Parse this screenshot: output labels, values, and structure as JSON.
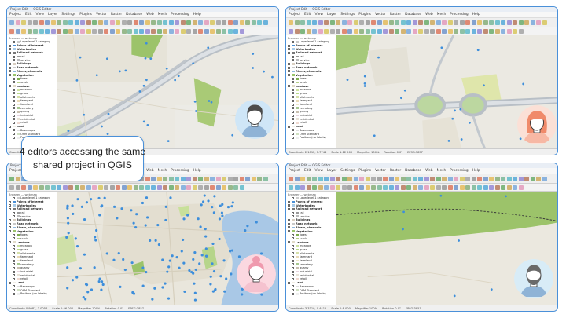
{
  "caption": {
    "line1": "4 editors accessing the same",
    "line2": "shared project in QGIS"
  },
  "window": {
    "title": "Project Edit — QGIS Editor",
    "menus": [
      "Project",
      "Edit",
      "View",
      "Layer",
      "Settings",
      "Plugins",
      "Vector",
      "Raster",
      "Database",
      "Web",
      "Mesh",
      "Processing",
      "Help"
    ]
  },
  "layers_panel": {
    "header": "Browser — webmap",
    "items": [
      {
        "label": "Layerlevel 1 category",
        "style": "normal",
        "swatch": "#cccccc"
      },
      {
        "label": "Points of interest",
        "style": "bold",
        "swatch": "#4a8fd6"
      },
      {
        "label": "Waterbodies",
        "style": "bold",
        "swatch": "#a9cbe8"
      },
      {
        "label": "Railroad network",
        "style": "bold",
        "swatch": "#777777"
      },
      {
        "label": "rail",
        "style": "normal",
        "swatch": "#999999"
      },
      {
        "label": "service",
        "style": "normal",
        "swatch": "#bbbbbb"
      },
      {
        "label": "Buildings",
        "style": "bold",
        "swatch": "#d9cfc1"
      },
      {
        "label": "Road network",
        "style": "bold",
        "swatch": "#c9c9c9"
      },
      {
        "label": "Rivers, channels",
        "style": "bold",
        "swatch": "#8fb8de"
      },
      {
        "label": "Vegetation",
        "style": "bold",
        "swatch": "#9bc56b"
      },
      {
        "label": "forest",
        "style": "normal",
        "swatch": "#7fae4f"
      },
      {
        "label": "scrub",
        "style": "normal",
        "swatch": "#b7d08a"
      },
      {
        "label": "Landuse",
        "style": "bold",
        "swatch": "#e2dcc8"
      },
      {
        "label": "meadow",
        "style": "normal",
        "swatch": "#cfe3a0"
      },
      {
        "label": "grass",
        "style": "normal",
        "swatch": "#b8d98a"
      },
      {
        "label": "allotments",
        "style": "normal",
        "swatch": "#d6e0a8"
      },
      {
        "label": "farmyard",
        "style": "normal",
        "swatch": "#e8d9b5"
      },
      {
        "label": "farmland",
        "style": "normal",
        "swatch": "#eee6c7"
      },
      {
        "label": "cemetery",
        "style": "normal",
        "swatch": "#a8c890"
      },
      {
        "label": "quarry",
        "style": "normal",
        "swatch": "#c9c0b0"
      },
      {
        "label": "industrial",
        "style": "normal",
        "swatch": "#e6d3dd"
      },
      {
        "label": "residential",
        "style": "normal",
        "swatch": "#e8e2d6"
      },
      {
        "label": "retail",
        "style": "normal",
        "swatch": "#f0d9d0"
      },
      {
        "label": "Land",
        "style": "bold",
        "swatch": "#f2efe6"
      },
      {
        "label": "Basemaps",
        "style": "normal",
        "swatch": "#dddddd"
      },
      {
        "label": "OSM Standard",
        "style": "normal",
        "swatch": "#cfe0c0"
      },
      {
        "label": "Positron (no labels)",
        "style": "normal",
        "swatch": "#eeeeee"
      }
    ]
  },
  "statusbar": {
    "panels": [
      {
        "coordinate": "Coordinate 1.2456, 2.8701",
        "scale": "Scale 1:40 000",
        "magnifier": "Magnifier 100%",
        "rotation": "Rotation 0.0°",
        "crs": "EPSG:3857"
      },
      {
        "coordinate": "Coordinate 2.1012, 1.7744",
        "scale": "Scale 1:12 500",
        "magnifier": "Magnifier 100%",
        "rotation": "Rotation 0.0°",
        "crs": "EPSG:3857"
      },
      {
        "coordinate": "Coordinate 0.9987, 3.0056",
        "scale": "Scale 1:56 000",
        "magnifier": "Magnifier 100%",
        "rotation": "Rotation 0.0°",
        "crs": "EPSG:3857"
      },
      {
        "coordinate": "Coordinate 3.3310, 0.4412",
        "scale": "Scale 1:8 000",
        "magnifier": "Magnifier 100%",
        "rotation": "Rotation 0.0°",
        "crs": "EPSG:3857"
      }
    ]
  },
  "editors": [
    {
      "panel": "top-left",
      "avatar": "man-short-hair-icon",
      "bg": "#cfe6f7",
      "hair": "#4b4b4b",
      "shirt": "#8fb3d6"
    },
    {
      "panel": "top-right",
      "avatar": "woman-orange-hair-icon",
      "bg": "#fbe0d6",
      "hair": "#f08a6a",
      "shirt": "#f7b8a4"
    },
    {
      "panel": "bottom-left",
      "avatar": "woman-bun-hair-icon",
      "bg": "#fbd8e0",
      "hair": "#ef9aae",
      "shirt": "#f5c2cf"
    },
    {
      "panel": "bottom-right",
      "avatar": "man-beard-icon",
      "bg": "#d8ecf7",
      "hair": "#6a6a6a",
      "shirt": "#8fb3d6"
    }
  ],
  "colors": {
    "frame": "#4a90d9",
    "poi": "#3d8edb",
    "vegetation": "#9cc36a",
    "water": "#a9c8e6",
    "road": "#b8bfc6"
  }
}
